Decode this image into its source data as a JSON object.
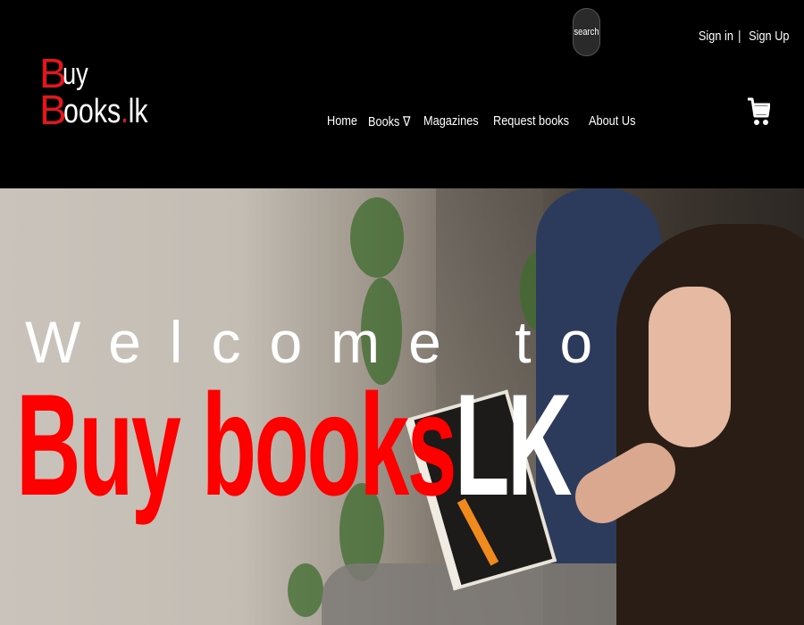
{
  "header": {
    "logo": {
      "initial_top": "B",
      "rest_top": "uy",
      "initial_bottom": "B",
      "rest_bottom": "ooks",
      "dot": ".",
      "suffix": "lk"
    },
    "search_label": "search",
    "auth": {
      "sign_in": "Sign in",
      "separator": "|",
      "sign_up": "Sign Up"
    },
    "nav": [
      {
        "label": "Home"
      },
      {
        "label": "Books ∇"
      },
      {
        "label": "Magazines"
      },
      {
        "label": "Request books"
      },
      {
        "label": "About Us"
      }
    ],
    "cart_icon": "shopping-cart-icon"
  },
  "hero": {
    "welcome": "Welcome to",
    "brand_red": "Buy books",
    "brand_white": "LK"
  },
  "colors": {
    "brand_red": "#e3161b",
    "header_bg": "#000000",
    "text_white": "#ffffff"
  }
}
